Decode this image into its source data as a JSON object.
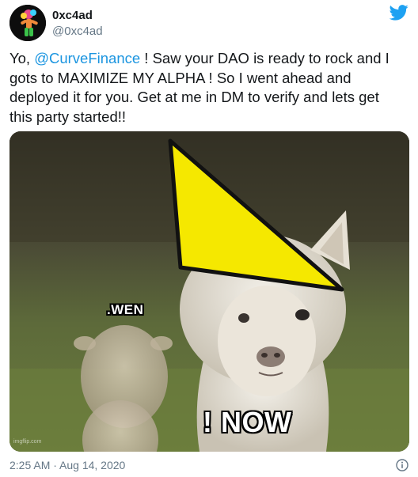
{
  "tweet": {
    "display_name": "0xc4ad",
    "handle": "@0xc4ad",
    "text_before_mention": "Yo, ",
    "mention": "@CurveFinance",
    "text_after_mention": " ! Saw your DAO is ready to rock and I gots to MAXIMIZE MY ALPHA ! So I went ahead and deployed it for you. Get at me in DM to verify and lets get this party started!!",
    "timestamp": "2:25 AM · Aug 14, 2020"
  },
  "media": {
    "caption_top": ".WEN",
    "caption_bottom": "! NOW",
    "watermark": "imgflip.com"
  },
  "icons": {
    "brand": "twitter-bird-icon",
    "info": "info-icon"
  },
  "colors": {
    "link": "#1b95e0",
    "muted": "#657786",
    "brand": "#1da1f2",
    "hat": "#f5e800"
  }
}
